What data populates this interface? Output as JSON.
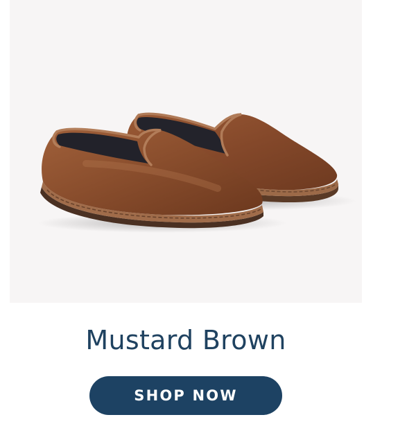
{
  "product": {
    "image_alt": "Velvet slippers",
    "title": "Mustard Brown",
    "cta_label": "SHOP NOW"
  },
  "colors": {
    "image_background": "#f7f5f5",
    "title_text": "#1f4260",
    "button_background": "#1d4263",
    "button_text": "#ffffff",
    "shoe_velvet": "#8a4e2d"
  }
}
